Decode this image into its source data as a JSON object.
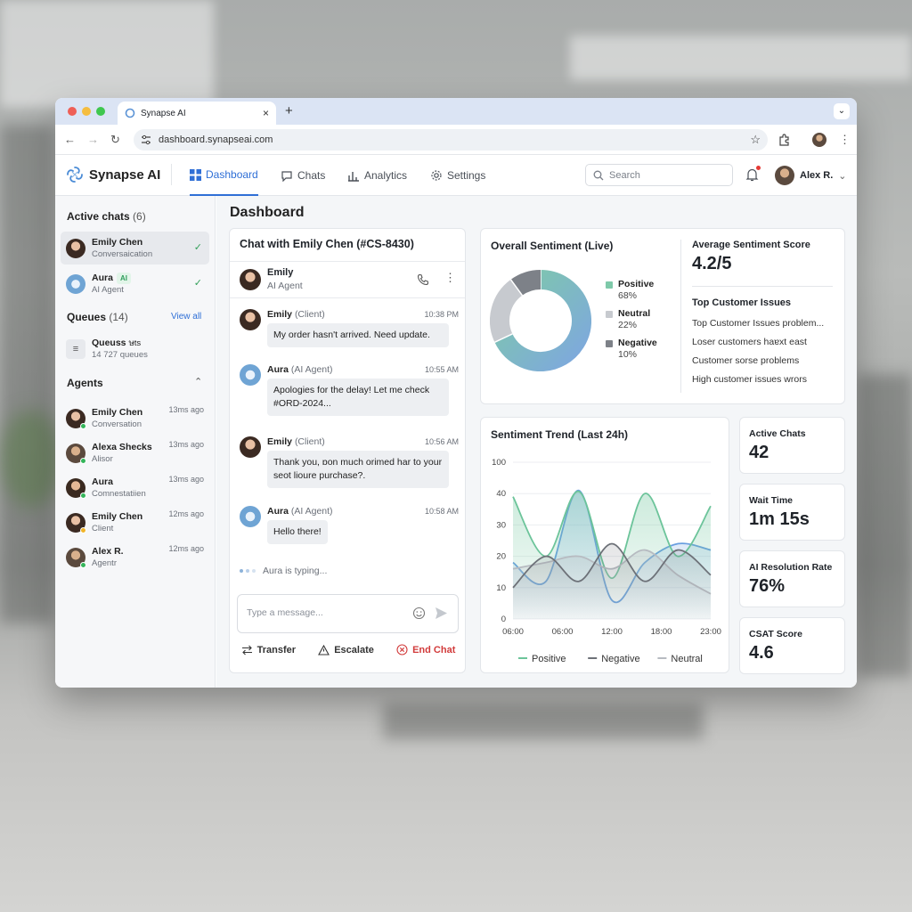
{
  "browser": {
    "tab_title": "Synapse AI",
    "url": "dashboard.synapseai.com"
  },
  "app": {
    "brand": "Synapse AI",
    "nav": [
      {
        "label": "Dashboard",
        "icon": "grid-icon",
        "active": true
      },
      {
        "label": "Chats",
        "icon": "chat-bubble-icon"
      },
      {
        "label": "Analytics",
        "icon": "bar-chart-icon"
      },
      {
        "label": "Settings",
        "icon": "gear-icon"
      }
    ],
    "search_placeholder": "Search",
    "user_name": "Alex R."
  },
  "sidebar": {
    "active_chats_title": "Active chats",
    "active_chats_count": "(6)",
    "active_chats": [
      {
        "name": "Emily Chen",
        "sub": "Conversaication"
      },
      {
        "name": "Aura",
        "tag": "AI",
        "sub": "AI Agent"
      }
    ],
    "queues_title": "Queues",
    "queues_count": "(14)",
    "view_all": "View all",
    "queue_item": {
      "name": "Queuss",
      "name_extra": "ษts",
      "sub": "14 727 queues"
    },
    "agents_title": "Agents",
    "agents": [
      {
        "name": "Emily Chen",
        "sub": "Conversation",
        "time": "13ms ago"
      },
      {
        "name": "Alexa Shecks",
        "sub": "Alisor",
        "time": "13ms ago"
      },
      {
        "name": "Aura",
        "sub": "Comnestatiien",
        "time": "13ms ago"
      },
      {
        "name": "Emily Chen",
        "sub": "Client",
        "time": "12ms ago"
      },
      {
        "name": "Alex R.",
        "sub": "Agentr",
        "time": "12ms ago"
      }
    ]
  },
  "main": {
    "title": "Dashboard",
    "chat": {
      "title": "Chat with Emily Chen (#CS-8430)",
      "header_name": "Emily",
      "header_role": "AI Agent",
      "messages": [
        {
          "who": "Emily",
          "role": "(Client)",
          "time": "10:38 PM",
          "text": "My order hasn't arrived. Need update."
        },
        {
          "who": "Aura",
          "role": "(AI Agent)",
          "time": "10:55 AM",
          "text": "Apologies for the delay! Let me check #ORD-2024..."
        },
        {
          "who": "Emily",
          "role": "(Client)",
          "time": "10:56 AM",
          "text": "Thank you, ɒon much orimed har to your seot lioure purchase?."
        },
        {
          "who": "Aura",
          "role": "(AI Agent)",
          "time": "10:58 AM",
          "text": "Hello there!"
        }
      ],
      "typing": "Aura is typing...",
      "input_placeholder": "Type a message...",
      "actions": {
        "transfer": "Transfer",
        "escalate": "Escalate",
        "end": "End Chat"
      }
    },
    "sentiment": {
      "title": "Overall Sentiment (Live)",
      "avg_label": "Average Sentiment Score",
      "avg_value": "4.2/5",
      "issues_title": "Top Customer Issues",
      "issues": [
        "Top Customer Issues problem...",
        "Loser customers haɐxt east",
        "Customer sorse problems",
        "High customer issues wrors"
      ]
    },
    "stats": [
      {
        "label": "Active Chats",
        "value": "42"
      },
      {
        "label": "Wait Time",
        "value": "1m 15s"
      },
      {
        "label": "AI Resolution Rate",
        "value": "76%"
      },
      {
        "label": "CSAT Score",
        "value": "4.6"
      }
    ]
  },
  "chart_data": [
    {
      "type": "pie",
      "title": "Overall Sentiment (Live)",
      "labels": [
        "Positive",
        "Neutral",
        "Negative"
      ],
      "values": [
        68,
        22,
        10
      ],
      "display": [
        "68%",
        "22%",
        "10%"
      ],
      "colors": [
        "#7ec9a9",
        "#c7cacf",
        "#7d8188"
      ],
      "colors_note_segments": [
        "#7ea8de",
        "#c7cacf",
        "#7d8188"
      ]
    },
    {
      "type": "area",
      "title": "Sentiment Trend (Last 24h)",
      "categories": [
        "06:00",
        "06:00",
        "12:00",
        "18:00",
        "23:00"
      ],
      "y_tick_labels": [
        "0",
        "10",
        "20",
        "30",
        "40",
        "100"
      ],
      "series": [
        {
          "name": "Positive",
          "color": "#6cc49a",
          "values": [
            39,
            20,
            44,
            13,
            40,
            20,
            36
          ]
        },
        {
          "name": "Negative",
          "color": "#6d7178",
          "values": [
            10,
            20,
            12,
            24,
            12,
            22,
            14
          ]
        },
        {
          "name": "Neutral",
          "color": "#b7bbc1",
          "values": [
            16,
            18,
            20,
            16,
            22,
            14,
            8
          ]
        },
        {
          "name": "",
          "color": "#6a9fe0",
          "values": [
            18,
            12,
            46,
            6,
            18,
            24,
            22
          ]
        }
      ],
      "legend": "bottom"
    }
  ]
}
